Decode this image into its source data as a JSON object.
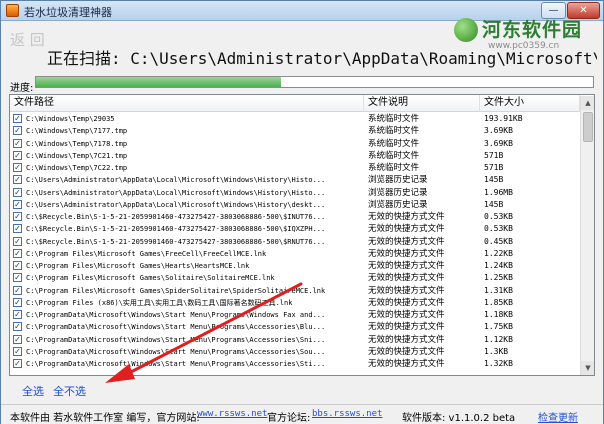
{
  "window": {
    "title": "若水垃圾清理神器",
    "minimize_glyph": "—",
    "close_glyph": "✕"
  },
  "watermark": {
    "title": "河东软件园",
    "url": "www.pc0359.cn"
  },
  "scan": {
    "faded_text": "返 回",
    "status_text": "正在扫描: C:\\Users\\Administrator\\AppData\\Roaming\\Microsoft\\Windows\\Recent",
    "progress_label": "进度:",
    "progress_fraction": 0.44
  },
  "table": {
    "columns": {
      "path": "文件路径",
      "desc": "文件说明",
      "size": "文件大小"
    },
    "rows": [
      {
        "path": "C:\\Windows\\Temp\\29035",
        "desc": "系统临时文件",
        "size": "193.91KB"
      },
      {
        "path": "C:\\Windows\\Temp\\7177.tmp",
        "desc": "系统临时文件",
        "size": "3.69KB"
      },
      {
        "path": "C:\\Windows\\Temp\\7178.tmp",
        "desc": "系统临时文件",
        "size": "3.69KB"
      },
      {
        "path": "C:\\Windows\\Temp\\7C21.tmp",
        "desc": "系统临时文件",
        "size": "571B"
      },
      {
        "path": "C:\\Windows\\Temp\\7C22.tmp",
        "desc": "系统临时文件",
        "size": "571B"
      },
      {
        "path": "C:\\Users\\Administrator\\AppData\\Local\\Microsoft\\Windows\\History\\Histo...",
        "desc": "浏览器历史记录",
        "size": "145B"
      },
      {
        "path": "C:\\Users\\Administrator\\AppData\\Local\\Microsoft\\Windows\\History\\Histo...",
        "desc": "浏览器历史记录",
        "size": "1.96MB"
      },
      {
        "path": "C:\\Users\\Administrator\\AppData\\Local\\Microsoft\\Windows\\History\\deskt...",
        "desc": "浏览器历史记录",
        "size": "145B"
      },
      {
        "path": "C:\\$Recycle.Bin\\S-1-5-21-2059901460-473275427-3803068886-500\\$INUT76...",
        "desc": "无效的快捷方式文件",
        "size": "0.53KB"
      },
      {
        "path": "C:\\$Recycle.Bin\\S-1-5-21-2059901460-473275427-3803068886-500\\$IQXZPH...",
        "desc": "无效的快捷方式文件",
        "size": "0.53KB"
      },
      {
        "path": "C:\\$Recycle.Bin\\S-1-5-21-2059901460-473275427-3803068886-500\\$RNUT76...",
        "desc": "无效的快捷方式文件",
        "size": "0.45KB"
      },
      {
        "path": "C:\\Program Files\\Microsoft Games\\FreeCell\\FreeCellMCE.lnk",
        "desc": "无效的快捷方式文件",
        "size": "1.22KB"
      },
      {
        "path": "C:\\Program Files\\Microsoft Games\\Hearts\\HeartsMCE.lnk",
        "desc": "无效的快捷方式文件",
        "size": "1.24KB"
      },
      {
        "path": "C:\\Program Files\\Microsoft Games\\Solitaire\\SolitaireMCE.lnk",
        "desc": "无效的快捷方式文件",
        "size": "1.25KB"
      },
      {
        "path": "C:\\Program Files\\Microsoft Games\\SpiderSolitaire\\SpiderSolitaireMCE.lnk",
        "desc": "无效的快捷方式文件",
        "size": "1.31KB"
      },
      {
        "path": "C:\\Program Files (x86)\\实用工具\\实用工具\\数码工具\\国际著名数码工具.lnk",
        "desc": "无效的快捷方式文件",
        "size": "1.85KB"
      },
      {
        "path": "C:\\ProgramData\\Microsoft\\Windows\\Start Menu\\Programs\\Windows Fax and...",
        "desc": "无效的快捷方式文件",
        "size": "1.18KB"
      },
      {
        "path": "C:\\ProgramData\\Microsoft\\Windows\\Start Menu\\Programs\\Accessories\\Blu...",
        "desc": "无效的快捷方式文件",
        "size": "1.75KB"
      },
      {
        "path": "C:\\ProgramData\\Microsoft\\Windows\\Start Menu\\Programs\\Accessories\\Sni...",
        "desc": "无效的快捷方式文件",
        "size": "1.12KB"
      },
      {
        "path": "C:\\ProgramData\\Microsoft\\Windows\\Start Menu\\Programs\\Accessories\\Sou...",
        "desc": "无效的快捷方式文件",
        "size": "1.3KB"
      },
      {
        "path": "C:\\ProgramData\\Microsoft\\Windows\\Start Menu\\Programs\\Accessories\\Sti...",
        "desc": "无效的快捷方式文件",
        "size": "1.32KB"
      }
    ]
  },
  "actions": {
    "select_all": "全选",
    "select_none": "全不选"
  },
  "status_bar": {
    "credit": "本软件由 若水软件工作室 编写，官方网站:",
    "site_url": "www.rssws.net",
    "forum_label": "官方论坛:",
    "forum_url": "bbs.rssws.net",
    "version": "软件版本: v1.1.0.2 beta",
    "update": "检查更新"
  },
  "colors": {
    "link": "#1f4fd6",
    "arrow": "#e02020",
    "progress": "#4caf50"
  }
}
